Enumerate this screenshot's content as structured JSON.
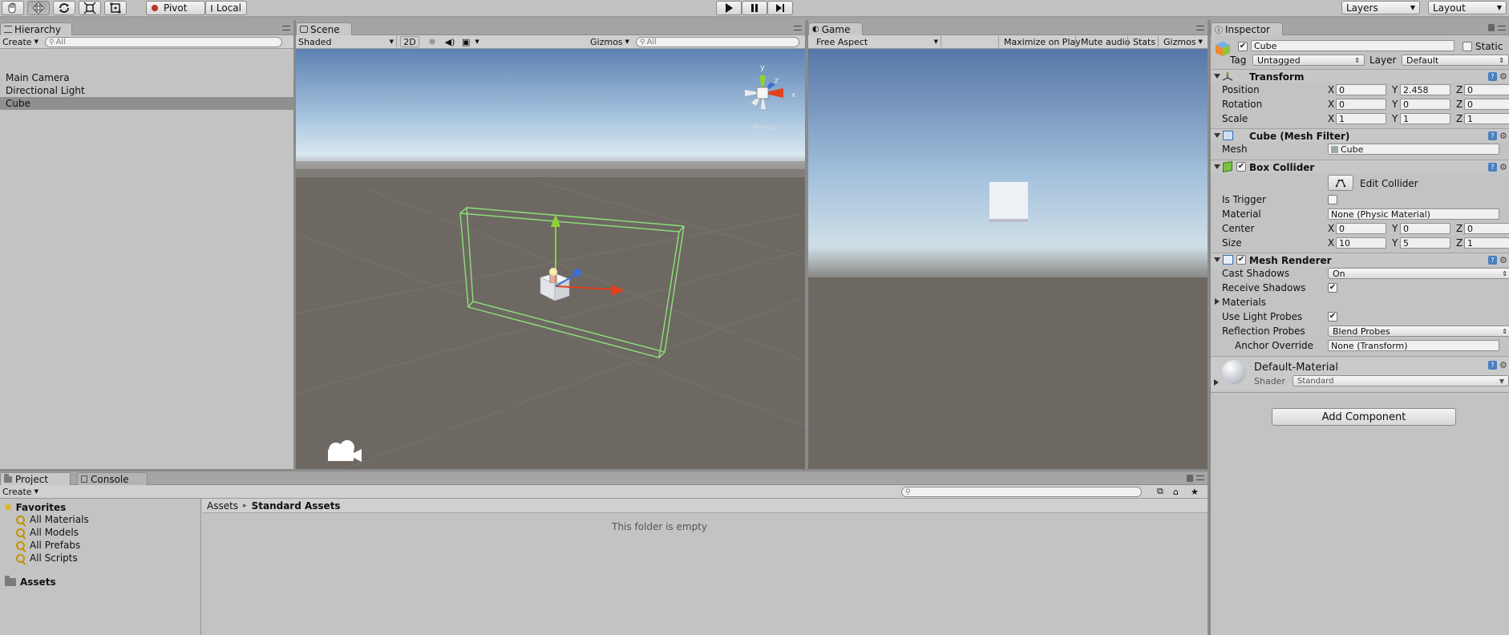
{
  "toolbar": {
    "tools": [
      {
        "name": "hand-tool"
      },
      {
        "name": "move-tool"
      },
      {
        "name": "rotate-tool"
      },
      {
        "name": "scale-tool"
      },
      {
        "name": "rect-tool"
      }
    ],
    "pivot_label": "Pivot",
    "local_label": "Local",
    "play_icon": "play-icon",
    "pause_icon": "pause-icon",
    "step_icon": "step-icon",
    "layers_label": "Layers",
    "layout_label": "Layout"
  },
  "hierarchy": {
    "tab_label": "Hierarchy",
    "create_label": "Create",
    "search_placeholder": "All",
    "items": [
      {
        "label": "Main Camera",
        "selected": false
      },
      {
        "label": "Directional Light",
        "selected": false
      },
      {
        "label": "Cube",
        "selected": true
      }
    ]
  },
  "scene": {
    "tab_label": "Scene",
    "shading_mode": "Shaded",
    "toggle_2d": "2D",
    "gizmos_label": "Gizmos",
    "search_placeholder": "All",
    "persp_label": "Persp",
    "axis_labels": {
      "y": "y",
      "z": "z",
      "x": "x"
    }
  },
  "game": {
    "tab_label": "Game",
    "aspect": "Free Aspect",
    "maximize_on_play": "Maximize on Play",
    "mute_audio": "Mute audio",
    "stats": "Stats",
    "gizmos": "Gizmos"
  },
  "inspector": {
    "tab_label": "Inspector",
    "object_name": "Cube",
    "active": true,
    "static_label": "Static",
    "tag_label": "Tag",
    "tag_value": "Untagged",
    "layer_label": "Layer",
    "layer_value": "Default",
    "transform": {
      "title": "Transform",
      "position_label": "Position",
      "rotation_label": "Rotation",
      "scale_label": "Scale",
      "position": {
        "x": "0",
        "y": "2.458",
        "z": "0"
      },
      "rotation": {
        "x": "0",
        "y": "0",
        "z": "0"
      },
      "scale": {
        "x": "1",
        "y": "1",
        "z": "1"
      }
    },
    "mesh_filter": {
      "title": "Cube (Mesh Filter)",
      "mesh_label": "Mesh",
      "mesh_value": "Cube"
    },
    "box_collider": {
      "title": "Box Collider",
      "enabled": true,
      "edit_collider_label": "Edit Collider",
      "is_trigger_label": "Is Trigger",
      "is_trigger": false,
      "material_label": "Material",
      "material_value": "None (Physic Material)",
      "center_label": "Center",
      "center": {
        "x": "0",
        "y": "0",
        "z": "0"
      },
      "size_label": "Size",
      "size": {
        "x": "10",
        "y": "5",
        "z": "1"
      }
    },
    "mesh_renderer": {
      "title": "Mesh Renderer",
      "enabled": true,
      "cast_shadows_label": "Cast Shadows",
      "cast_shadows_value": "On",
      "receive_shadows_label": "Receive Shadows",
      "receive_shadows": true,
      "materials_label": "Materials",
      "use_light_probes_label": "Use Light Probes",
      "use_light_probes": true,
      "reflection_probes_label": "Reflection Probes",
      "reflection_probes_value": "Blend Probes",
      "anchor_override_label": "Anchor Override",
      "anchor_override_value": "None (Transform)"
    },
    "material": {
      "name": "Default-Material",
      "shader_label": "Shader",
      "shader_value": "Standard"
    },
    "add_component_label": "Add Component",
    "axis": {
      "x": "X",
      "y": "Y",
      "z": "Z"
    }
  },
  "project": {
    "tab_label": "Project",
    "console_tab_label": "Console",
    "create_label": "Create",
    "favorites_label": "Favorites",
    "favorites": [
      "All Materials",
      "All Models",
      "All Prefabs",
      "All Scripts"
    ],
    "assets_label": "Assets",
    "breadcrumb": {
      "root": "Assets",
      "separator": "▸",
      "current": "Standard Assets"
    },
    "empty_message": "This folder is empty"
  },
  "colors": {
    "panel_bg": "#c3c3c3",
    "selection": "#8f8f8f",
    "collider_green": "#8ee07a",
    "gizmo_y": "#8ad432",
    "gizmo_x": "#e0401a",
    "gizmo_z": "#3a6fd8"
  }
}
